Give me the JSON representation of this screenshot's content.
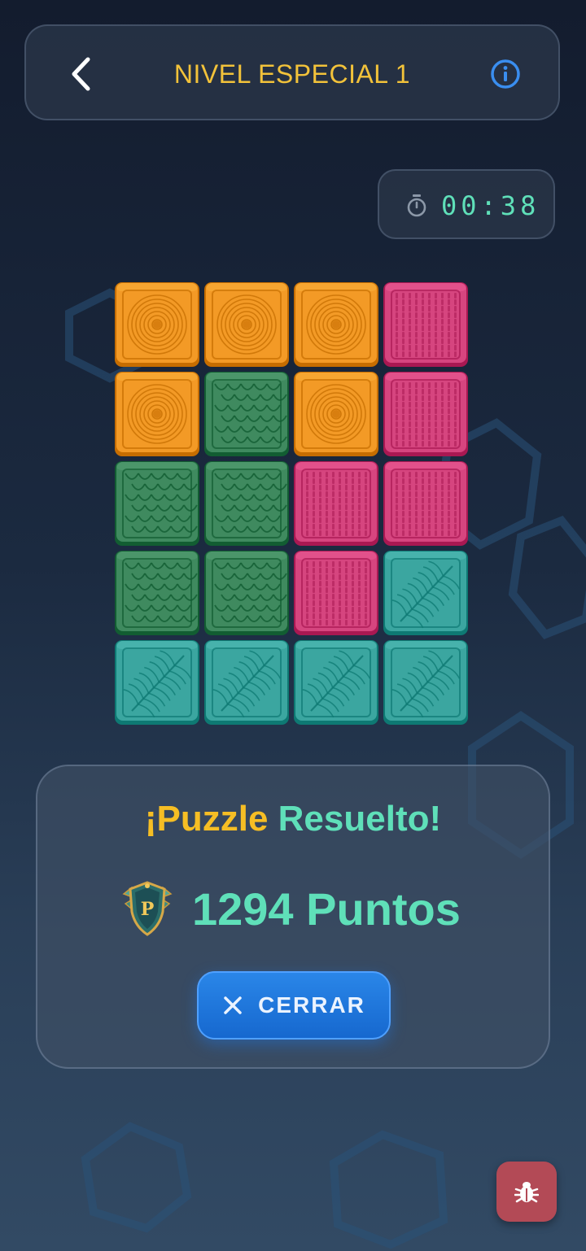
{
  "header": {
    "title": "NIVEL ESPECIAL 1",
    "back_icon": "chevron-left-icon",
    "info_icon": "info-circle-icon"
  },
  "timer": {
    "icon": "stopwatch-icon",
    "value": "00:38"
  },
  "board": {
    "columns": 4,
    "rows": 5,
    "tiles": [
      [
        "orange",
        "orange",
        "orange",
        "pink"
      ],
      [
        "orange",
        "green",
        "orange",
        "pink"
      ],
      [
        "green",
        "green",
        "pink",
        "pink"
      ],
      [
        "green",
        "green",
        "pink",
        "teal"
      ],
      [
        "teal",
        "teal",
        "teal",
        "teal"
      ]
    ],
    "tile_types": {
      "orange": {
        "pattern": "concentric-circles",
        "color": "#f39a26"
      },
      "pink": {
        "pattern": "woven",
        "color": "#d6457f"
      },
      "green": {
        "pattern": "scales",
        "color": "#3f8a5f"
      },
      "teal": {
        "pattern": "leaf",
        "color": "#3ba6a0"
      }
    }
  },
  "result": {
    "title_part1": "¡Puzzle",
    "title_part2": "Resuelto!",
    "badge_icon": "p-shield-badge-icon",
    "score_text": "1294 Puntos",
    "close_icon": "close-x-icon",
    "close_label": "CERRAR"
  },
  "debug_button": {
    "icon": "bug-icon"
  },
  "colors": {
    "accent_yellow": "#f2c23a",
    "accent_green": "#5fe0b9",
    "button_blue": "#1f78e0",
    "debug_red": "#b34a56",
    "info_blue": "#3a8ef0"
  }
}
